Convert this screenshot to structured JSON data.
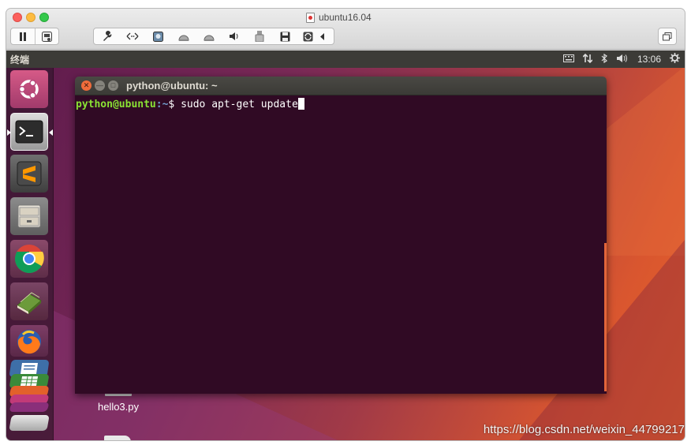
{
  "vm": {
    "title": "ubuntu16.04",
    "toolbar_icons": [
      "pause-icon",
      "snapshot-icon",
      "wrench-icon",
      "network-arrows-icon",
      "hdd-icon",
      "disc-icon",
      "disc2-icon",
      "speaker-icon",
      "usb-icon",
      "save-icon",
      "refresh-icon",
      "chevron-left-icon"
    ],
    "fullscreen_icon": "window-restore-icon"
  },
  "topbar": {
    "app_title": "终端",
    "clock": "13:06",
    "indicators": [
      "keyboard-icon",
      "network-updown-icon",
      "bluetooth-icon",
      "volume-icon",
      "gear-icon"
    ]
  },
  "launcher": {
    "items": [
      "ubuntu-dash",
      "terminal",
      "sublime-text",
      "file-manager",
      "chrome",
      "book-reader",
      "firefox",
      "libreoffice-writer",
      "libreoffice-calc",
      "libreoffice-impress",
      "printer"
    ]
  },
  "terminal": {
    "title": "python@ubuntu: ~",
    "prompt_user": "python@ubuntu",
    "prompt_path": ":~",
    "prompt_symbol": "$ ",
    "command": "sudo apt-get update"
  },
  "desktop": {
    "file_label": "hello3.py"
  },
  "watermark": "https://blog.csdn.net/weixin_44799217",
  "colors": {
    "terminal_bg": "#300a24",
    "prompt_user": "#8ae234",
    "prompt_path": "#729fcf",
    "topbar_bg": "#3c3b37",
    "close_orange": "#f06c3b"
  }
}
